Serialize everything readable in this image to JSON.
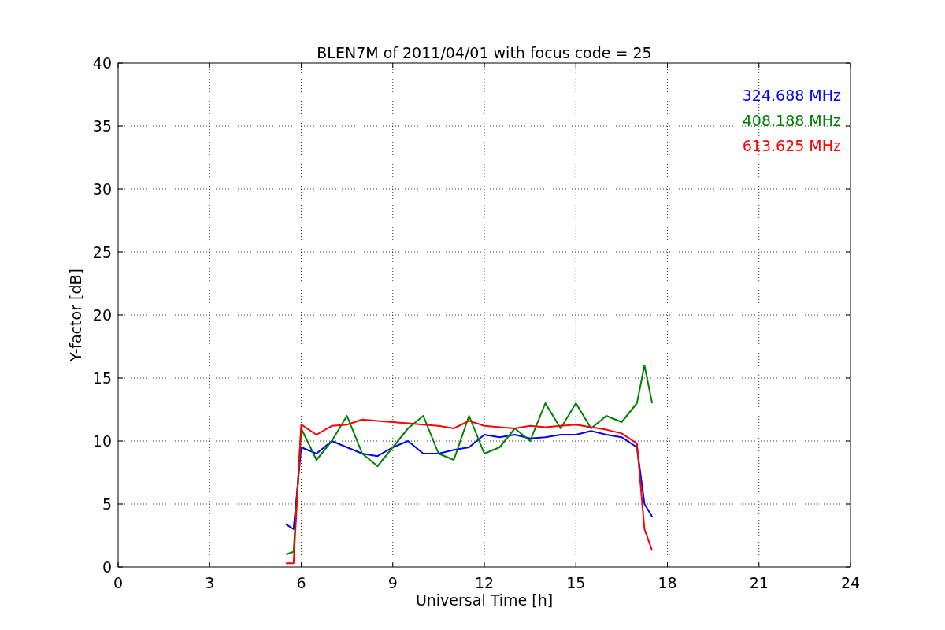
{
  "figure": {
    "chart_data": {
      "type": "line",
      "title": "BLEN7M of 2011/04/01 with focus code = 25",
      "xlabel": "Universal Time [h]",
      "ylabel": "Y-factor [dB]",
      "x": [
        5.5,
        5.75,
        6,
        6.5,
        7,
        7.5,
        8,
        8.5,
        9,
        9.5,
        10,
        10.5,
        11,
        11.5,
        12,
        12.5,
        13,
        13.5,
        14,
        14.5,
        15,
        15.5,
        16,
        16.5,
        17,
        17.25,
        17.5
      ],
      "series": [
        {
          "name": "324.688 MHz",
          "color": "#0000ff",
          "values": [
            3.4,
            3.0,
            9.5,
            9,
            10,
            9.5,
            9,
            8.8,
            9.5,
            10,
            9,
            9,
            9.3,
            9.5,
            10.5,
            10.3,
            10.5,
            10.2,
            10.3,
            10.5,
            10.5,
            10.8,
            10.5,
            10.3,
            9.5,
            5,
            4
          ]
        },
        {
          "name": "408.188 MHz",
          "color": "#008000",
          "values": [
            1,
            1.2,
            11,
            8.5,
            10,
            12,
            9,
            8,
            9.5,
            11,
            12,
            9,
            8.5,
            12,
            9,
            9.5,
            11,
            10,
            13,
            11,
            13,
            11,
            12,
            11.5,
            13,
            16,
            13
          ]
        },
        {
          "name": "613.625 MHz",
          "color": "#ff0000",
          "values": [
            0.3,
            0.3,
            11.3,
            10.5,
            11.2,
            11.3,
            11.7,
            11.6,
            11.5,
            11.4,
            11.3,
            11.2,
            11,
            11.6,
            11.2,
            11.1,
            11,
            11.2,
            11.1,
            11.2,
            11.3,
            11.1,
            10.9,
            10.6,
            9.8,
            3,
            1.3
          ]
        }
      ],
      "grid": true,
      "xlim": [
        0,
        24
      ],
      "ylim": [
        0,
        40
      ],
      "xticks": [
        0,
        3,
        6,
        9,
        12,
        15,
        18,
        21,
        24
      ],
      "yticks": [
        0,
        5,
        10,
        15,
        20,
        25,
        30,
        35,
        40
      ]
    }
  }
}
